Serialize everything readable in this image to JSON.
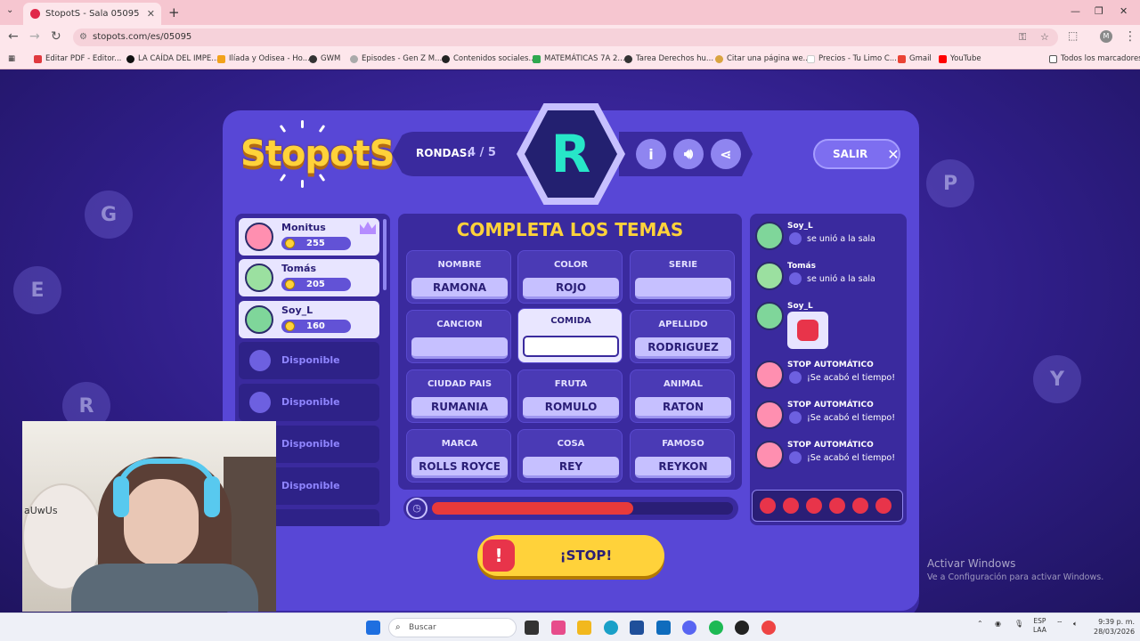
{
  "browser": {
    "tab_title": "StopotS - Sala 05095",
    "url": "stopots.com/es/05095",
    "bookmarks": [
      "Editar PDF - Editor...",
      "LA CAÍDA DEL IMPE...",
      "Ilíada y Odisea - Ho...",
      "GWM",
      "Episodes - Gen Z M...",
      "Contenidos sociales...",
      "MATEMÁTICAS 7A 2...",
      "Tarea Derechos hu...",
      "Citar una página we...",
      "Precios - Tu Limo C...",
      "Gmail",
      "YouTube"
    ],
    "all_bookmarks": "Todos los marcadores"
  },
  "game": {
    "logo": "StopotS",
    "rounds_label": "RONDAS:",
    "rounds_value": "4 / 5",
    "letter": "R",
    "exit_label": "SALIR",
    "title": "COMPLETA LOS TEMAS",
    "stop_label": "¡STOP!",
    "timer_progress": 0.67,
    "players": [
      {
        "name": "Monitus",
        "points": "255",
        "crown": true
      },
      {
        "name": "Tomás",
        "points": "205"
      },
      {
        "name": "Soy_L",
        "points": "160"
      }
    ],
    "available_label": "Disponible",
    "topics": [
      {
        "category": "NOMBRE",
        "answer": "RAMONA"
      },
      {
        "category": "COLOR",
        "answer": "ROJO"
      },
      {
        "category": "SERIE",
        "answer": ""
      },
      {
        "category": "CANCION",
        "answer": ""
      },
      {
        "category": "COMIDA",
        "answer": ""
      },
      {
        "category": "APELLIDO",
        "answer": "RODRIGUEZ"
      },
      {
        "category": "CIUDAD PAIS",
        "answer": "RUMANIA"
      },
      {
        "category": "FRUTA",
        "answer": "ROMULO"
      },
      {
        "category": "ANIMAL",
        "answer": "RATON"
      },
      {
        "category": "MARCA",
        "answer": "ROLLS ROYCE"
      },
      {
        "category": "COSA",
        "answer": "REY"
      },
      {
        "category": "FAMOSO",
        "answer": "REYKON"
      }
    ],
    "chat": [
      {
        "who": "Soy_L",
        "text": "se unió a la sala"
      },
      {
        "who": "Tomás",
        "text": "se unió a la sala"
      },
      {
        "who": "Soy_L",
        "text": ""
      },
      {
        "who": "STOP AUTOMÁTICO",
        "text": "¡Se acabó el tiempo!"
      },
      {
        "who": "STOP AUTOMÁTICO",
        "text": "¡Se acabó el tiempo!"
      },
      {
        "who": "STOP AUTOMÁTICO",
        "text": "¡Se acabó el tiempo!"
      }
    ]
  },
  "webcam": {
    "poster_text": "aUwUs"
  },
  "windows": {
    "activate_title": "Activar Windows",
    "activate_sub": "Ve a Configuración para activar Windows.",
    "search_placeholder": "Buscar",
    "lang_top": "ESP",
    "lang_bottom": "LAA",
    "time": "9:39 p. m.",
    "date": "28/03/2026"
  }
}
